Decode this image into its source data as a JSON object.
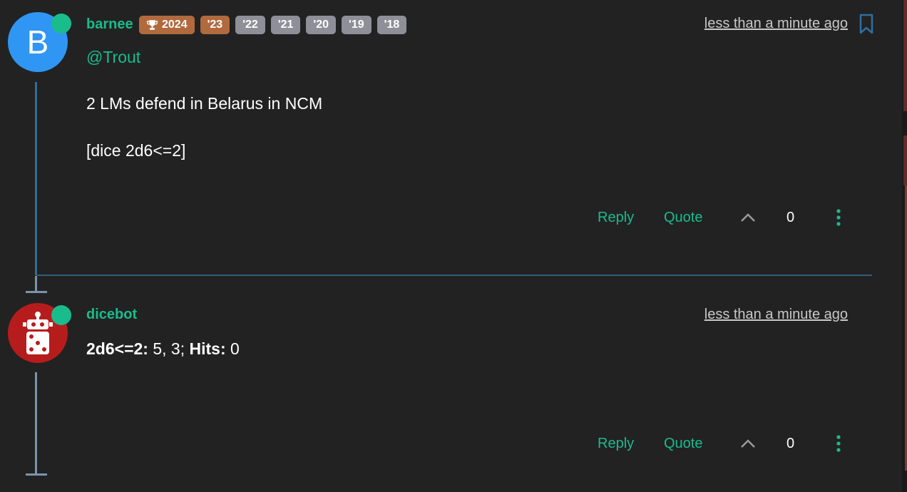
{
  "posts": [
    {
      "avatar_letter": "B",
      "username": "barnee",
      "badges": [
        "2024",
        "'23",
        "'22",
        "'21",
        "'20",
        "'19",
        "'18"
      ],
      "timestamp": "less than a minute ago",
      "mention": "@Trout",
      "body_lines": [
        "2 LMs defend in Belarus in NCM",
        "[dice 2d6<=2]"
      ],
      "reply_label": "Reply",
      "quote_label": "Quote",
      "vote_count": "0"
    },
    {
      "username": "dicebot",
      "timestamp": "less than a minute ago",
      "result_expr": "2d6<=2:",
      "result_rolls": " 5, 3; ",
      "hits_label": "Hits:",
      "hits_value": " 0",
      "reply_label": "Reply",
      "quote_label": "Quote",
      "vote_count": "0"
    }
  ],
  "colors": {
    "accent": "#1abc8c",
    "background": "#222222",
    "avatar_barnee": "#2f96f3",
    "avatar_dicebot": "#b71c1c",
    "badge_gold": "#b06a3e",
    "badge_grey": "#8f8f99",
    "bookmark": "#2f6f9f"
  },
  "icons": [
    "trophy-icon",
    "bookmark-icon",
    "upvote-icon",
    "more-icon",
    "robot-dice-icon"
  ]
}
